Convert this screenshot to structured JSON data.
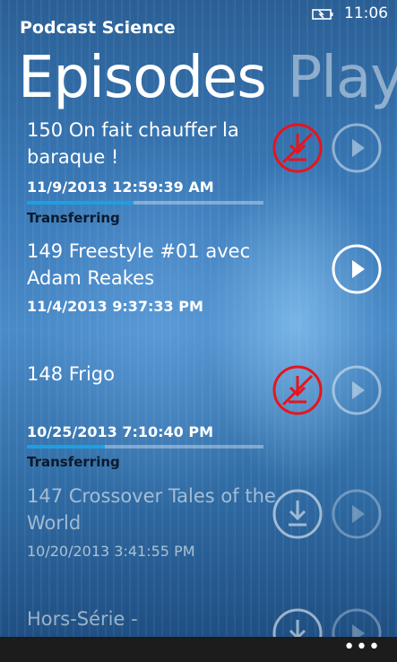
{
  "status_bar": {
    "battery_icon": "battery-charging-icon",
    "time": "11:06"
  },
  "app": {
    "name": "Podcast Science"
  },
  "pivot": {
    "active": "Episodes",
    "next": "Playlis"
  },
  "episodes": [
    {
      "title_line1": "150 On fait chauffer la",
      "title_line2": "baraque !",
      "date": "11/9/2013 12:59:39 AM",
      "status": "Transferring",
      "progress": 0.45,
      "action_icon": "cancel-download-icon",
      "play_icon": "play-icon",
      "play_enabled": false
    },
    {
      "title_line1": "149 Freestyle #01 avec",
      "title_line2": "Adam Reakes",
      "date": "11/4/2013 9:37:33 PM",
      "status": "",
      "action_icon": "",
      "play_icon": "play-icon",
      "play_enabled": true
    },
    {
      "title_line1": "148 Frigo",
      "title_line2": "",
      "date": "10/25/2013 7:10:40 PM",
      "status": "Transferring",
      "progress": 0.33,
      "action_icon": "cancel-download-icon",
      "play_icon": "play-icon",
      "play_enabled": false
    },
    {
      "title_line1": "147 Crossover Tales of the",
      "title_line2": "World",
      "date": "10/20/2013 3:41:55 PM",
      "status": "",
      "action_icon": "download-icon",
      "play_icon": "play-icon",
      "play_enabled": false
    },
    {
      "title_line1": "Hors-Série -",
      "title_line2": "",
      "date": "",
      "status": "",
      "action_icon": "download-icon",
      "play_icon": "play-icon",
      "play_enabled": false
    }
  ],
  "app_bar": {
    "more_label": "•••"
  },
  "colors": {
    "cancel": "#e8141c",
    "progress": "#1ba1e2",
    "status_text": "#0b1a2c"
  }
}
